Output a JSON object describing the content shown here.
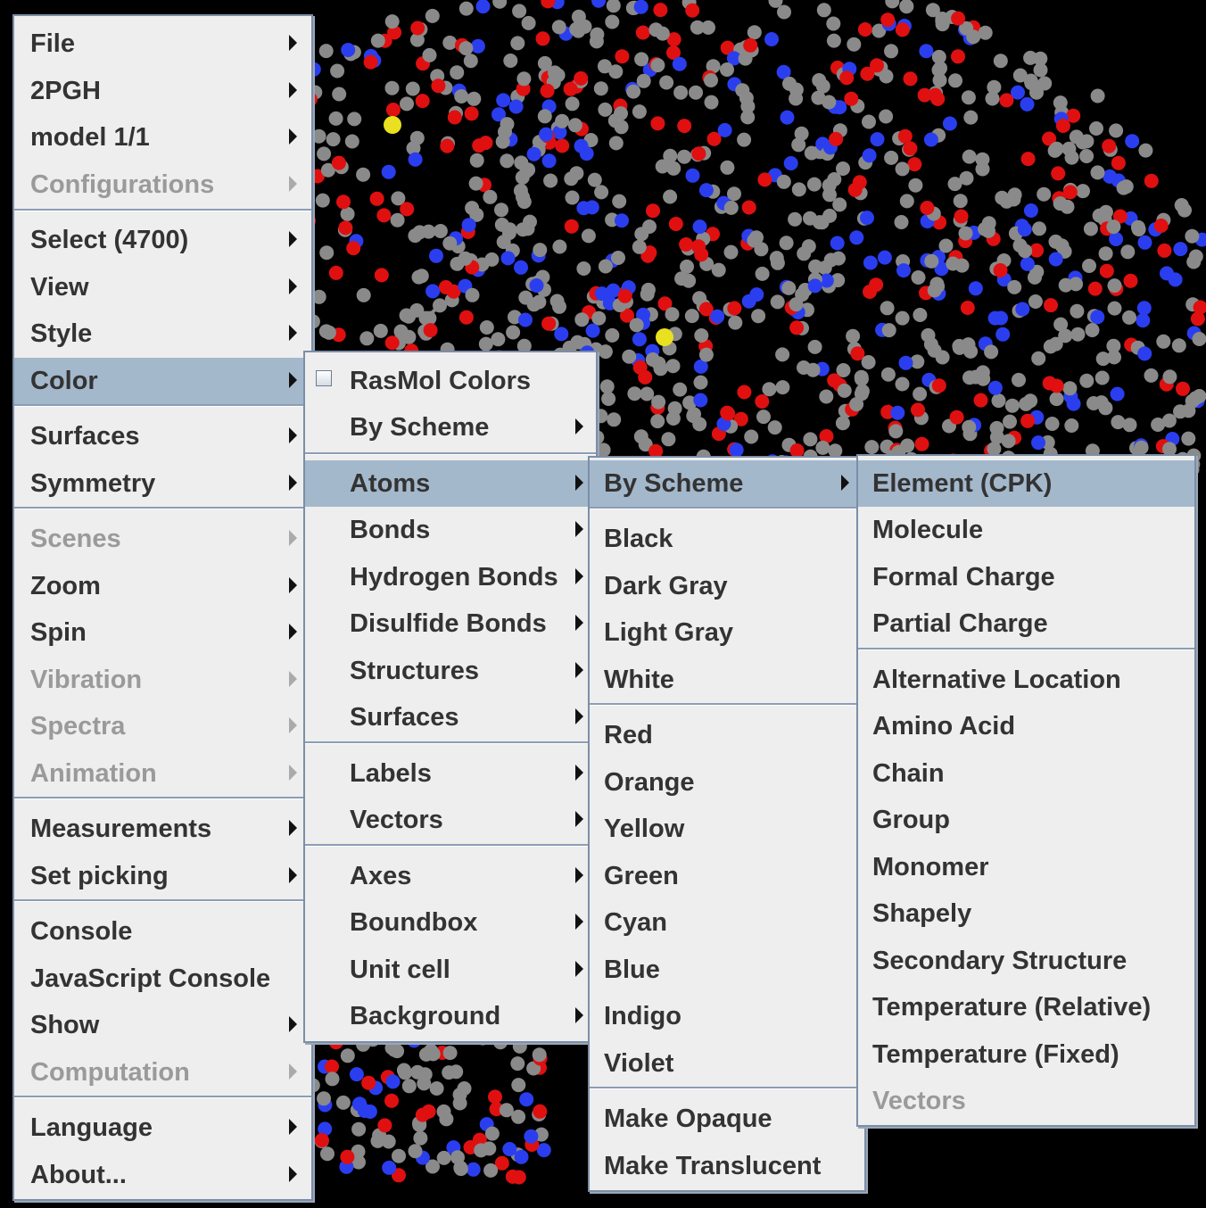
{
  "colors": {
    "menu_bg": "#eeeeee",
    "selected_bg": "#a4b8cc",
    "menu_border": "#7b8ea8",
    "text": "#333333",
    "disabled_text": "#9a9a9a",
    "atom_carbon": "#8a8a8a",
    "atom_oxygen": "#e01010",
    "atom_nitrogen": "#2a3ef0",
    "atom_sulfur": "#e8e020",
    "background": "#000000"
  },
  "main_menu": {
    "items": [
      {
        "label": "File",
        "submenu": true,
        "disabled": false,
        "selected": false
      },
      {
        "label": "2PGH",
        "submenu": true,
        "disabled": false,
        "selected": false
      },
      {
        "label": "model 1/1",
        "submenu": true,
        "disabled": false,
        "selected": false
      },
      {
        "label": "Configurations",
        "submenu": true,
        "disabled": true,
        "selected": false
      },
      {
        "label": "Select (4700)",
        "submenu": true,
        "disabled": false,
        "selected": false
      },
      {
        "label": "View",
        "submenu": true,
        "disabled": false,
        "selected": false
      },
      {
        "label": "Style",
        "submenu": true,
        "disabled": false,
        "selected": false
      },
      {
        "label": "Color",
        "submenu": true,
        "disabled": false,
        "selected": true
      },
      {
        "label": "Surfaces",
        "submenu": true,
        "disabled": false,
        "selected": false
      },
      {
        "label": "Symmetry",
        "submenu": true,
        "disabled": false,
        "selected": false
      },
      {
        "label": "Scenes",
        "submenu": true,
        "disabled": true,
        "selected": false
      },
      {
        "label": "Zoom",
        "submenu": true,
        "disabled": false,
        "selected": false
      },
      {
        "label": "Spin",
        "submenu": true,
        "disabled": false,
        "selected": false
      },
      {
        "label": "Vibration",
        "submenu": true,
        "disabled": true,
        "selected": false
      },
      {
        "label": "Spectra",
        "submenu": true,
        "disabled": true,
        "selected": false
      },
      {
        "label": "Animation",
        "submenu": true,
        "disabled": true,
        "selected": false
      },
      {
        "label": "Measurements",
        "submenu": true,
        "disabled": false,
        "selected": false
      },
      {
        "label": "Set picking",
        "submenu": true,
        "disabled": false,
        "selected": false
      },
      {
        "label": "Console",
        "submenu": false,
        "disabled": false,
        "selected": false
      },
      {
        "label": "JavaScript Console",
        "submenu": false,
        "disabled": false,
        "selected": false
      },
      {
        "label": "Show",
        "submenu": true,
        "disabled": false,
        "selected": false
      },
      {
        "label": "Computation",
        "submenu": true,
        "disabled": true,
        "selected": false
      },
      {
        "label": "Language",
        "submenu": true,
        "disabled": false,
        "selected": false
      },
      {
        "label": "About...",
        "submenu": true,
        "disabled": false,
        "selected": false
      }
    ]
  },
  "color_menu": {
    "items": [
      {
        "label": "RasMol Colors",
        "checkbox": true,
        "checked": false,
        "submenu": false,
        "selected": false
      },
      {
        "label": "By Scheme",
        "submenu": true,
        "selected": false
      },
      {
        "label": "Atoms",
        "submenu": true,
        "selected": true
      },
      {
        "label": "Bonds",
        "submenu": true,
        "selected": false
      },
      {
        "label": "Hydrogen Bonds",
        "submenu": true,
        "selected": false
      },
      {
        "label": "Disulfide Bonds",
        "submenu": true,
        "selected": false
      },
      {
        "label": "Structures",
        "submenu": true,
        "selected": false
      },
      {
        "label": "Surfaces",
        "submenu": true,
        "selected": false
      },
      {
        "label": "Labels",
        "submenu": true,
        "selected": false
      },
      {
        "label": "Vectors",
        "submenu": true,
        "selected": false
      },
      {
        "label": "Axes",
        "submenu": true,
        "selected": false
      },
      {
        "label": "Boundbox",
        "submenu": true,
        "selected": false
      },
      {
        "label": "Unit cell",
        "submenu": true,
        "selected": false
      },
      {
        "label": "Background",
        "submenu": true,
        "selected": false
      }
    ]
  },
  "atoms_menu": {
    "items": [
      {
        "label": "By Scheme",
        "submenu": true,
        "selected": true
      },
      {
        "label": "Black",
        "submenu": false,
        "selected": false
      },
      {
        "label": "Dark Gray",
        "submenu": false,
        "selected": false
      },
      {
        "label": "Light Gray",
        "submenu": false,
        "selected": false
      },
      {
        "label": "White",
        "submenu": false,
        "selected": false
      },
      {
        "label": "Red",
        "submenu": false,
        "selected": false
      },
      {
        "label": "Orange",
        "submenu": false,
        "selected": false
      },
      {
        "label": "Yellow",
        "submenu": false,
        "selected": false
      },
      {
        "label": "Green",
        "submenu": false,
        "selected": false
      },
      {
        "label": "Cyan",
        "submenu": false,
        "selected": false
      },
      {
        "label": "Blue",
        "submenu": false,
        "selected": false
      },
      {
        "label": "Indigo",
        "submenu": false,
        "selected": false
      },
      {
        "label": "Violet",
        "submenu": false,
        "selected": false
      },
      {
        "label": "Make Opaque",
        "submenu": false,
        "selected": false
      },
      {
        "label": "Make Translucent",
        "submenu": false,
        "selected": false
      }
    ]
  },
  "scheme_menu": {
    "items": [
      {
        "label": "Element (CPK)",
        "disabled": false,
        "selected": true
      },
      {
        "label": "Molecule",
        "disabled": false,
        "selected": false
      },
      {
        "label": "Formal Charge",
        "disabled": false,
        "selected": false
      },
      {
        "label": "Partial Charge",
        "disabled": false,
        "selected": false
      },
      {
        "label": "Alternative Location",
        "disabled": false,
        "selected": false
      },
      {
        "label": "Amino Acid",
        "disabled": false,
        "selected": false
      },
      {
        "label": "Chain",
        "disabled": false,
        "selected": false
      },
      {
        "label": "Group",
        "disabled": false,
        "selected": false
      },
      {
        "label": "Monomer",
        "disabled": false,
        "selected": false
      },
      {
        "label": "Shapely",
        "disabled": false,
        "selected": false
      },
      {
        "label": "Secondary Structure",
        "disabled": false,
        "selected": false
      },
      {
        "label": "Temperature (Relative)",
        "disabled": false,
        "selected": false
      },
      {
        "label": "Temperature (Fixed)",
        "disabled": false,
        "selected": false
      },
      {
        "label": "Vectors",
        "disabled": true,
        "selected": false
      }
    ]
  }
}
